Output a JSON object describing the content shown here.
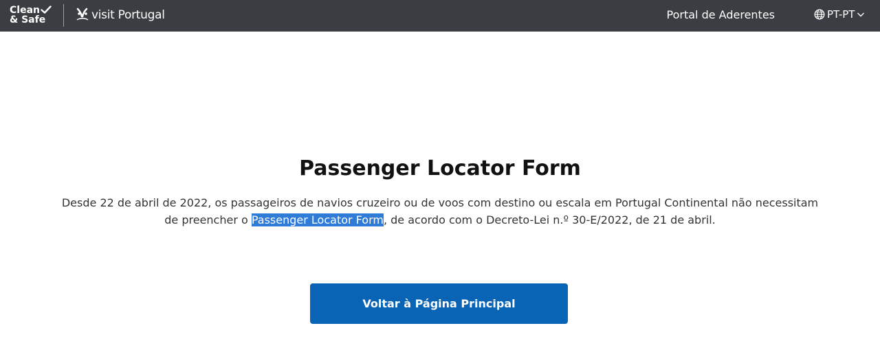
{
  "header": {
    "brand_line1": "Clean",
    "brand_line2": "& Safe",
    "visit_logo_text": "visit Portugal",
    "portal_link": "Portal de Aderentes",
    "language": "PT-PT"
  },
  "main": {
    "title": "Passenger Locator Form",
    "desc_before": "Desde 22 de abril de 2022, os passageiros de navios cruzeiro ou de voos com destino ou escala em Portugal Continental não necessitam de preencher o ",
    "desc_highlight": "Passenger Locator Form",
    "desc_after": ", de acordo com o Decreto-Lei n.º 30-E/2022, de 21 de abril.",
    "button_label": "Voltar à Página Principal"
  },
  "colors": {
    "header_bg": "#3a3d41",
    "button_bg": "#0a64b6",
    "selection_highlight": "#2f7bd8"
  },
  "icons": [
    "checkmark-icon",
    "visit-portugal-logo-icon",
    "globe-icon",
    "chevron-down-icon"
  ]
}
